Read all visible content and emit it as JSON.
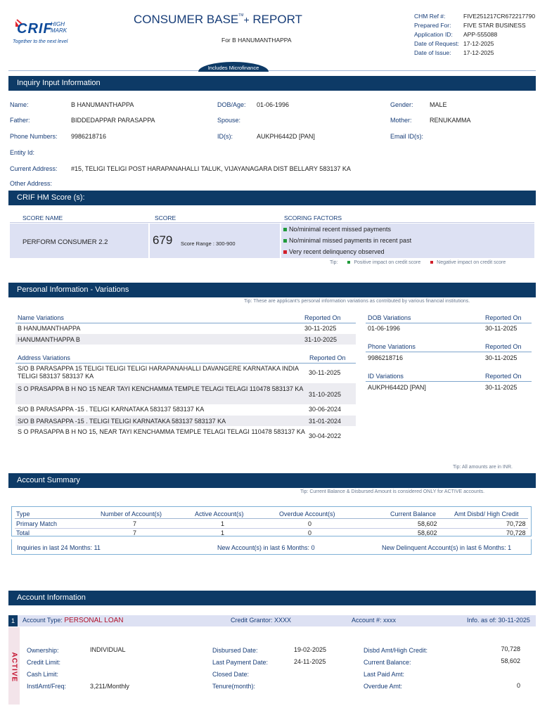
{
  "header": {
    "logo_text": "CRIF",
    "logo_sub": "HIGH MARK",
    "tagline": "Together to the next level",
    "title": "CONSUMER BASE",
    "title_tm": "TM",
    "title_plus": "+",
    "title_report": "REPORT",
    "for_line": "For B HANUMANTHAPPA",
    "microfinance_tab": "Includes Microfinance",
    "meta_labels": [
      "CHM Ref #:",
      "Prepared For:",
      "Application ID:",
      "Date of Request:",
      "Date of Issue:"
    ],
    "meta_values": [
      "FIVE251217CR672217790",
      "FIVE STAR BUSINESS",
      "APP-555088",
      "17-12-2025",
      "17-12-2025"
    ]
  },
  "inquiry": {
    "section_title": "Inquiry Input Information",
    "name_label": "Name:",
    "name": "B HANUMANTHAPPA",
    "dob_label": "DOB/Age:",
    "dob": "01-06-1996",
    "gender_label": "Gender:",
    "gender": "MALE",
    "father_label": "Father:",
    "father": "BIDDEDAPPAR PARASAPPA",
    "spouse_label": "Spouse:",
    "spouse": "",
    "mother_label": "Mother:",
    "mother": "RENUKAMMA",
    "phone_label": "Phone Numbers:",
    "phone": "9986218716",
    "ids_label": "ID(s):",
    "ids": "AUKPH6442D [PAN]",
    "email_label": "Email ID(s):",
    "email": "",
    "entity_label": "Entity Id:",
    "entity": "",
    "address_label": "Current Address:",
    "address": "#15, TELIGI TELIGI POST HARAPANAHALLI TALUK, VIJAYANAGARA DIST BELLARY 583137 KA",
    "other_address_label": "Other Address:",
    "other_address": ""
  },
  "score": {
    "section_title": "CRIF HM Score (s):",
    "col_name": "SCORE NAME",
    "col_score": "SCORE",
    "col_factors": "SCORING FACTORS",
    "score_name": "PERFORM CONSUMER 2.2",
    "score_value": "679",
    "score_range": "Score Range : 300-900",
    "factors": [
      {
        "text": "No/minimal recent missed payments",
        "color": "#1f9a3a"
      },
      {
        "text": "No/minimal missed payments in recent past",
        "color": "#1f9a3a"
      },
      {
        "text": "Very recent delinquency observed",
        "color": "#d11f2a"
      }
    ],
    "tip_label": "Tip:",
    "tip_positive": "Positive impact on credit score",
    "tip_negative": "Negative impact on credit score",
    "positive_color": "#1f9a3a",
    "negative_color": "#d11f2a"
  },
  "personal": {
    "section_title": "Personal Information - Variations",
    "tip": "Tip: These are applicant's personal information variations as contributed by various financial institutions.",
    "reported_on": "Reported On",
    "name_head": "Name Variations",
    "names": [
      {
        "value": "B HANUMANTHAPPA",
        "date": "30-11-2025"
      },
      {
        "value": "HANUMANTHAPPA B",
        "date": "31-10-2025"
      }
    ],
    "address_head": "Address Variations",
    "addresses": [
      {
        "value": "S/O B PARASAPPA 15 TELIGI TELIGI TELIGI HARAPANAHALLI DAVANGERE KARNATAKA INDIA TELIGI 583137 583137 KA",
        "date": "30-11-2025"
      },
      {
        "value": "S O PRASAPPA B H NO 15 NEAR TAYI KENCHAMMA TEMPLE TELAGI TELAGI 110478 583137 KA",
        "date": "31-10-2025"
      },
      {
        "value": "S/O B PARASAPPA -15 . TELIGI KARNATAKA 583137 583137 KA",
        "date": "30-06-2024"
      },
      {
        "value": "S/O B PARASAPPA -15 . TELIGI TELIGI KARNATAKA 583137 583137 KA",
        "date": "31-01-2024"
      },
      {
        "value": "S O PRASAPPA B H NO 15, NEAR TAYI KENCHAMMA TEMPLE TELAGI TELAGI 110478 583137 KA",
        "date": "30-04-2022"
      }
    ],
    "dob_head": "DOB Variations",
    "dobs": [
      {
        "value": "01-06-1996",
        "date": "30-11-2025"
      }
    ],
    "phone_head": "Phone Variations",
    "phones": [
      {
        "value": "9986218716",
        "date": "30-11-2025"
      }
    ],
    "id_head": "ID Variations",
    "ids": [
      {
        "value": "AUKPH6442D [PAN]",
        "date": "30-11-2025"
      }
    ],
    "inr_tip": "Tip: All amounts are in INR."
  },
  "summary": {
    "section_title": "Account Summary",
    "tip": "Tip: Current Balance & Disbursed Amount is considered ONLY for ACTIVE accounts.",
    "columns": [
      "Type",
      "Number of Account(s)",
      "Active Account(s)",
      "Overdue Account(s)",
      "Current Balance",
      "Amt Disbd/ High Credit"
    ],
    "rows": [
      [
        "Primary Match",
        "7",
        "1",
        "0",
        "58,602",
        "70,728"
      ],
      [
        "Total",
        "7",
        "1",
        "0",
        "58,602",
        "70,728"
      ]
    ],
    "inquiries_label": "Inquiries in last 24 Months:",
    "inquiries": "11",
    "new_accounts_label": "New Account(s) in last 6 Months:",
    "new_accounts": "0",
    "new_delinquent_label": "New Delinquent Account(s) in last 6 Months:",
    "new_delinquent": "1"
  },
  "account": {
    "section_title": "Account Information",
    "index": "1",
    "type_label": "Account Type:",
    "type": "PERSONAL LOAN",
    "grantor": "Credit Grantor: XXXX",
    "acct_no": "Account #: xxxx",
    "info_as_of": "Info. as of: 30-11-2025",
    "status": "ACTIVE",
    "ownership_label": "Ownership:",
    "ownership": "INDIVIDUAL",
    "credit_limit_label": "Credit Limit:",
    "credit_limit": "",
    "cash_limit_label": "Cash Limit:",
    "cash_limit": "",
    "instl_label": "InstlAmt/Freq:",
    "instl": "3,211/Monthly",
    "disbursed_label": "Disbursed Date:",
    "disbursed": "19-02-2025",
    "last_payment_label": "Last Payment Date:",
    "last_payment": "24-11-2025",
    "closed_label": "Closed Date:",
    "closed": "",
    "tenure_label": "Tenure(month):",
    "tenure": "",
    "disbd_amt_label": "Disbd Amt/High Credit:",
    "disbd_amt": "70,728",
    "current_balance_label": "Current Balance:",
    "current_balance": "58,602",
    "last_paid_label": "Last Paid Amt:",
    "last_paid": "",
    "overdue_label": "Overdue Amt:",
    "overdue": "0"
  }
}
